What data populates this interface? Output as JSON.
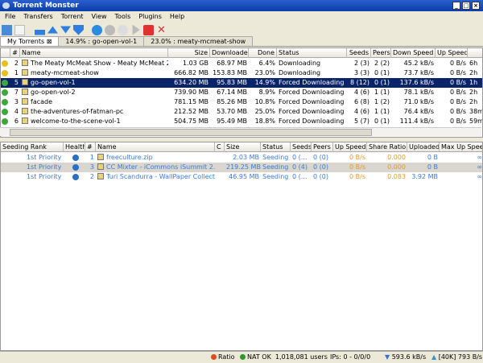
{
  "window": {
    "title": "Torrent Monster"
  },
  "menu": [
    "File",
    "Transfers",
    "Torrent",
    "View",
    "Tools",
    "Plugins",
    "Help"
  ],
  "tabs": [
    "My Torrents",
    "14.9% : go-open-vol-1",
    "23.0% : meaty-mcmeat-show"
  ],
  "top_table": {
    "columns": [
      "#",
      "Name",
      "Size",
      "Downloaded",
      "Done",
      "Status",
      "Seeds",
      "Peers",
      "Down Speed",
      "Up Speed",
      ""
    ],
    "rows": [
      {
        "n": "2",
        "name": "The Meaty McMeat Show - Meaty McMeat 2 ...",
        "size": "1.03 GB",
        "dl": "68.97 MB",
        "done": "6.4%",
        "status": "Downloading",
        "seeds": "2 (3)",
        "peers": "2 (2)",
        "down": "45.2 kB/s",
        "up": "0 B/s",
        "eta": "6h",
        "dot": "#e8c020"
      },
      {
        "n": "1",
        "name": "meaty-mcmeat-show",
        "size": "666.82 MB",
        "dl": "153.83 MB",
        "done": "23.0%",
        "status": "Downloading",
        "seeds": "3 (3)",
        "peers": "0 (1)",
        "down": "73.7 kB/s",
        "up": "0 B/s",
        "eta": "2h",
        "dot": "#e8c020"
      },
      {
        "n": "5",
        "name": "go-open-vol-1",
        "size": "634.20 MB",
        "dl": "95.83 MB",
        "done": "14.9%",
        "status": "Forced Downloading",
        "seeds": "8 (12)",
        "peers": "0 (1)",
        "down": "137.6 kB/s",
        "up": "0 B/s",
        "eta": "1h",
        "dot": "#3ca83c",
        "selected": true
      },
      {
        "n": "7",
        "name": "go-open-vol-2",
        "size": "739.90 MB",
        "dl": "67.14 MB",
        "done": "8.9%",
        "status": "Forced Downloading",
        "seeds": "4 (6)",
        "peers": "1 (1)",
        "down": "78.1 kB/s",
        "up": "0 B/s",
        "eta": "2h",
        "dot": "#3ca83c"
      },
      {
        "n": "3",
        "name": "facade",
        "size": "781.15 MB",
        "dl": "85.26 MB",
        "done": "10.8%",
        "status": "Forced Downloading",
        "seeds": "6 (8)",
        "peers": "1 (2)",
        "down": "71.0 kB/s",
        "up": "0 B/s",
        "eta": "2h",
        "dot": "#3ca83c"
      },
      {
        "n": "4",
        "name": "the-adventures-of-fatman-pc",
        "size": "212.52 MB",
        "dl": "53.70 MB",
        "done": "25.0%",
        "status": "Forced Downloading",
        "seeds": "4 (6)",
        "peers": "1 (1)",
        "down": "76.4 kB/s",
        "up": "0 B/s",
        "eta": "38m",
        "dot": "#3ca83c"
      },
      {
        "n": "6",
        "name": "welcome-to-the-scene-vol-1",
        "size": "504.75 MB",
        "dl": "95.49 MB",
        "done": "18.8%",
        "status": "Forced Downloading",
        "seeds": "5 (7)",
        "peers": "0 (1)",
        "down": "111.4 kB/s",
        "up": "0 B/s",
        "eta": "59m",
        "dot": "#3ca83c"
      }
    ]
  },
  "bottom_table": {
    "columns": [
      "Seeding Rank",
      "Health",
      "#",
      "Name",
      "C",
      "Size",
      "Status",
      "Seeds",
      "Peers",
      "Up Speed",
      "Share Ratio",
      "Uploaded",
      "Max Up Speed"
    ],
    "rows": [
      {
        "rank": "1st Priority",
        "n": "1",
        "name": "freeculture.zip",
        "size": "2.03 MB",
        "status": "Seeding",
        "seeds": "0 (...",
        "peers": "0 (0)",
        "up": "0 B/s",
        "ratio": "0.000",
        "uploaded": "0 B",
        "max": "∞"
      },
      {
        "rank": "1st Priority",
        "n": "3",
        "name": "CC Mixter - iCommons iSummit 2...",
        "size": "219.25 MB",
        "status": "Seeding",
        "seeds": "0 (4)",
        "peers": "0 (0)",
        "up": "0 B/s",
        "ratio": "0.000",
        "uploaded": "0 B",
        "max": "∞"
      },
      {
        "rank": "1st Priority",
        "n": "2",
        "name": "Turi Scandurra - WallPaper Collect...",
        "size": "46.95 MB",
        "status": "Seeding",
        "seeds": "0 (...",
        "peers": "0 (0)",
        "up": "0 B/s",
        "ratio": "0.083",
        "uploaded": "3.92 MB",
        "max": "∞"
      }
    ]
  },
  "status": {
    "ratio": "Ratio",
    "nat": "NAT OK",
    "users": "1,018,081 users",
    "ips": "IPs: 0 - 0/0/0",
    "down": "593.6 kB/s",
    "up": "[40K] 793 B/s"
  }
}
